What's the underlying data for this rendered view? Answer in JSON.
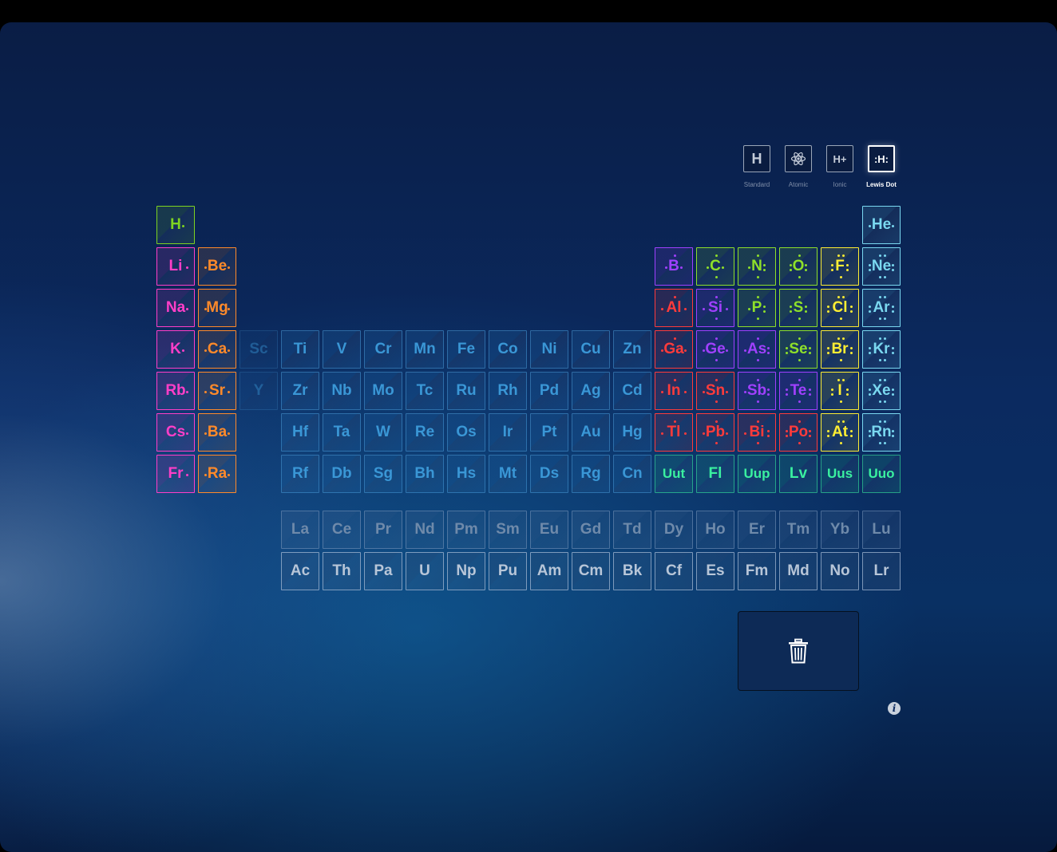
{
  "modes": [
    {
      "id": "standard",
      "icon_text": "H",
      "label": "Standard",
      "selected": false
    },
    {
      "id": "atomic",
      "icon_text": "",
      "icon": "atom-icon",
      "label": "Atomic",
      "selected": false
    },
    {
      "id": "ionic",
      "icon_text": "H+",
      "label": "Ionic",
      "selected": false
    },
    {
      "id": "lewis",
      "icon_text": ":H:",
      "label": "Lewis Dot",
      "selected": true
    }
  ],
  "colors": {
    "alkali": "#ff3ec8",
    "alkaline": "#ff8a2a",
    "hydrogen": "#7ed321",
    "transition": "#2f8fd0",
    "post_transition": "#ff3b3b",
    "metalloid": "#a040ff",
    "nonmetal": "#8ee02a",
    "halogen": "#ffee33",
    "noble": "#7ad8f0",
    "unknown": "#3af0a0",
    "lanthanide": "#6a86a8",
    "actinide": "#b7c4d6"
  },
  "elements": [
    {
      "s": "H",
      "r": 1,
      "c": 1,
      "k": "hydrogen",
      "v": 1
    },
    {
      "s": "He",
      "r": 1,
      "c": 18,
      "k": "noble",
      "v": 2
    },
    {
      "s": "Li",
      "r": 2,
      "c": 1,
      "k": "alkali",
      "v": 1
    },
    {
      "s": "Be",
      "r": 2,
      "c": 2,
      "k": "alkaline",
      "v": 2
    },
    {
      "s": "B",
      "r": 2,
      "c": 13,
      "k": "metalloid",
      "v": 3
    },
    {
      "s": "C",
      "r": 2,
      "c": 14,
      "k": "nonmetal",
      "v": 4
    },
    {
      "s": "N",
      "r": 2,
      "c": 15,
      "k": "nonmetal",
      "v": 5
    },
    {
      "s": "O",
      "r": 2,
      "c": 16,
      "k": "nonmetal",
      "v": 6
    },
    {
      "s": "F",
      "r": 2,
      "c": 17,
      "k": "halogen",
      "v": 7
    },
    {
      "s": "Ne",
      "r": 2,
      "c": 18,
      "k": "noble",
      "v": 8
    },
    {
      "s": "Na",
      "r": 3,
      "c": 1,
      "k": "alkali",
      "v": 1
    },
    {
      "s": "Mg",
      "r": 3,
      "c": 2,
      "k": "alkaline",
      "v": 2
    },
    {
      "s": "Al",
      "r": 3,
      "c": 13,
      "k": "post_transition",
      "v": 3
    },
    {
      "s": "Si",
      "r": 3,
      "c": 14,
      "k": "metalloid",
      "v": 4
    },
    {
      "s": "P",
      "r": 3,
      "c": 15,
      "k": "nonmetal",
      "v": 5
    },
    {
      "s": "S",
      "r": 3,
      "c": 16,
      "k": "nonmetal",
      "v": 6
    },
    {
      "s": "Cl",
      "r": 3,
      "c": 17,
      "k": "halogen",
      "v": 7
    },
    {
      "s": "Ar",
      "r": 3,
      "c": 18,
      "k": "noble",
      "v": 8
    },
    {
      "s": "K",
      "r": 4,
      "c": 1,
      "k": "alkali",
      "v": 1
    },
    {
      "s": "Ca",
      "r": 4,
      "c": 2,
      "k": "alkaline",
      "v": 2
    },
    {
      "s": "Sc",
      "r": 4,
      "c": 3,
      "k": "transition",
      "v": 0
    },
    {
      "s": "Ti",
      "r": 4,
      "c": 4,
      "k": "transition",
      "v": 0
    },
    {
      "s": "V",
      "r": 4,
      "c": 5,
      "k": "transition",
      "v": 0
    },
    {
      "s": "Cr",
      "r": 4,
      "c": 6,
      "k": "transition",
      "v": 0
    },
    {
      "s": "Mn",
      "r": 4,
      "c": 7,
      "k": "transition",
      "v": 0
    },
    {
      "s": "Fe",
      "r": 4,
      "c": 8,
      "k": "transition",
      "v": 0
    },
    {
      "s": "Co",
      "r": 4,
      "c": 9,
      "k": "transition",
      "v": 0
    },
    {
      "s": "Ni",
      "r": 4,
      "c": 10,
      "k": "transition",
      "v": 0
    },
    {
      "s": "Cu",
      "r": 4,
      "c": 11,
      "k": "transition",
      "v": 0
    },
    {
      "s": "Zn",
      "r": 4,
      "c": 12,
      "k": "transition",
      "v": 0
    },
    {
      "s": "Ga",
      "r": 4,
      "c": 13,
      "k": "post_transition",
      "v": 3
    },
    {
      "s": "Ge",
      "r": 4,
      "c": 14,
      "k": "metalloid",
      "v": 4
    },
    {
      "s": "As",
      "r": 4,
      "c": 15,
      "k": "metalloid",
      "v": 5
    },
    {
      "s": "Se",
      "r": 4,
      "c": 16,
      "k": "nonmetal",
      "v": 6
    },
    {
      "s": "Br",
      "r": 4,
      "c": 17,
      "k": "halogen",
      "v": 7
    },
    {
      "s": "Kr",
      "r": 4,
      "c": 18,
      "k": "noble",
      "v": 8
    },
    {
      "s": "Rb",
      "r": 5,
      "c": 1,
      "k": "alkali",
      "v": 1
    },
    {
      "s": "Sr",
      "r": 5,
      "c": 2,
      "k": "alkaline",
      "v": 2
    },
    {
      "s": "Y",
      "r": 5,
      "c": 3,
      "k": "transition",
      "v": 0
    },
    {
      "s": "Zr",
      "r": 5,
      "c": 4,
      "k": "transition",
      "v": 0
    },
    {
      "s": "Nb",
      "r": 5,
      "c": 5,
      "k": "transition",
      "v": 0
    },
    {
      "s": "Mo",
      "r": 5,
      "c": 6,
      "k": "transition",
      "v": 0
    },
    {
      "s": "Tc",
      "r": 5,
      "c": 7,
      "k": "transition",
      "v": 0
    },
    {
      "s": "Ru",
      "r": 5,
      "c": 8,
      "k": "transition",
      "v": 0
    },
    {
      "s": "Rh",
      "r": 5,
      "c": 9,
      "k": "transition",
      "v": 0
    },
    {
      "s": "Pd",
      "r": 5,
      "c": 10,
      "k": "transition",
      "v": 0
    },
    {
      "s": "Ag",
      "r": 5,
      "c": 11,
      "k": "transition",
      "v": 0
    },
    {
      "s": "Cd",
      "r": 5,
      "c": 12,
      "k": "transition",
      "v": 0
    },
    {
      "s": "In",
      "r": 5,
      "c": 13,
      "k": "post_transition",
      "v": 3
    },
    {
      "s": "Sn",
      "r": 5,
      "c": 14,
      "k": "post_transition",
      "v": 4
    },
    {
      "s": "Sb",
      "r": 5,
      "c": 15,
      "k": "metalloid",
      "v": 5
    },
    {
      "s": "Te",
      "r": 5,
      "c": 16,
      "k": "metalloid",
      "v": 6
    },
    {
      "s": "I",
      "r": 5,
      "c": 17,
      "k": "halogen",
      "v": 7
    },
    {
      "s": "Xe",
      "r": 5,
      "c": 18,
      "k": "noble",
      "v": 8
    },
    {
      "s": "Cs",
      "r": 6,
      "c": 1,
      "k": "alkali",
      "v": 1
    },
    {
      "s": "Ba",
      "r": 6,
      "c": 2,
      "k": "alkaline",
      "v": 2
    },
    {
      "s": "Hf",
      "r": 6,
      "c": 4,
      "k": "transition",
      "v": 0
    },
    {
      "s": "Ta",
      "r": 6,
      "c": 5,
      "k": "transition",
      "v": 0
    },
    {
      "s": "W",
      "r": 6,
      "c": 6,
      "k": "transition",
      "v": 0
    },
    {
      "s": "Re",
      "r": 6,
      "c": 7,
      "k": "transition",
      "v": 0
    },
    {
      "s": "Os",
      "r": 6,
      "c": 8,
      "k": "transition",
      "v": 0
    },
    {
      "s": "Ir",
      "r": 6,
      "c": 9,
      "k": "transition",
      "v": 0
    },
    {
      "s": "Pt",
      "r": 6,
      "c": 10,
      "k": "transition",
      "v": 0
    },
    {
      "s": "Au",
      "r": 6,
      "c": 11,
      "k": "transition",
      "v": 0
    },
    {
      "s": "Hg",
      "r": 6,
      "c": 12,
      "k": "transition",
      "v": 0
    },
    {
      "s": "Tl",
      "r": 6,
      "c": 13,
      "k": "post_transition",
      "v": 3
    },
    {
      "s": "Pb",
      "r": 6,
      "c": 14,
      "k": "post_transition",
      "v": 4
    },
    {
      "s": "Bi",
      "r": 6,
      "c": 15,
      "k": "post_transition",
      "v": 5
    },
    {
      "s": "Po",
      "r": 6,
      "c": 16,
      "k": "post_transition",
      "v": 6
    },
    {
      "s": "At",
      "r": 6,
      "c": 17,
      "k": "halogen",
      "v": 7
    },
    {
      "s": "Rn",
      "r": 6,
      "c": 18,
      "k": "noble",
      "v": 8
    },
    {
      "s": "Fr",
      "r": 7,
      "c": 1,
      "k": "alkali",
      "v": 1
    },
    {
      "s": "Ra",
      "r": 7,
      "c": 2,
      "k": "alkaline",
      "v": 2
    },
    {
      "s": "Rf",
      "r": 7,
      "c": 4,
      "k": "transition",
      "v": 0
    },
    {
      "s": "Db",
      "r": 7,
      "c": 5,
      "k": "transition",
      "v": 0
    },
    {
      "s": "Sg",
      "r": 7,
      "c": 6,
      "k": "transition",
      "v": 0
    },
    {
      "s": "Bh",
      "r": 7,
      "c": 7,
      "k": "transition",
      "v": 0
    },
    {
      "s": "Hs",
      "r": 7,
      "c": 8,
      "k": "transition",
      "v": 0
    },
    {
      "s": "Mt",
      "r": 7,
      "c": 9,
      "k": "transition",
      "v": 0
    },
    {
      "s": "Ds",
      "r": 7,
      "c": 10,
      "k": "transition",
      "v": 0
    },
    {
      "s": "Rg",
      "r": 7,
      "c": 11,
      "k": "transition",
      "v": 0
    },
    {
      "s": "Cn",
      "r": 7,
      "c": 12,
      "k": "transition",
      "v": 0
    },
    {
      "s": "Uut",
      "r": 7,
      "c": 13,
      "k": "unknown",
      "v": 0
    },
    {
      "s": "Fl",
      "r": 7,
      "c": 14,
      "k": "unknown",
      "v": 0
    },
    {
      "s": "Uup",
      "r": 7,
      "c": 15,
      "k": "unknown",
      "v": 0
    },
    {
      "s": "Lv",
      "r": 7,
      "c": 16,
      "k": "unknown",
      "v": 0
    },
    {
      "s": "Uus",
      "r": 7,
      "c": 17,
      "k": "unknown",
      "v": 0
    },
    {
      "s": "Uuo",
      "r": 7,
      "c": 18,
      "k": "unknown",
      "v": 0
    },
    {
      "s": "La",
      "r": 8,
      "c": 4,
      "k": "lanthanide",
      "v": 0
    },
    {
      "s": "Ce",
      "r": 8,
      "c": 5,
      "k": "lanthanide",
      "v": 0
    },
    {
      "s": "Pr",
      "r": 8,
      "c": 6,
      "k": "lanthanide",
      "v": 0
    },
    {
      "s": "Nd",
      "r": 8,
      "c": 7,
      "k": "lanthanide",
      "v": 0
    },
    {
      "s": "Pm",
      "r": 8,
      "c": 8,
      "k": "lanthanide",
      "v": 0
    },
    {
      "s": "Sm",
      "r": 8,
      "c": 9,
      "k": "lanthanide",
      "v": 0
    },
    {
      "s": "Eu",
      "r": 8,
      "c": 10,
      "k": "lanthanide",
      "v": 0
    },
    {
      "s": "Gd",
      "r": 8,
      "c": 11,
      "k": "lanthanide",
      "v": 0
    },
    {
      "s": "Td",
      "r": 8,
      "c": 12,
      "k": "lanthanide",
      "v": 0
    },
    {
      "s": "Dy",
      "r": 8,
      "c": 13,
      "k": "lanthanide",
      "v": 0
    },
    {
      "s": "Ho",
      "r": 8,
      "c": 14,
      "k": "lanthanide",
      "v": 0
    },
    {
      "s": "Er",
      "r": 8,
      "c": 15,
      "k": "lanthanide",
      "v": 0
    },
    {
      "s": "Tm",
      "r": 8,
      "c": 16,
      "k": "lanthanide",
      "v": 0
    },
    {
      "s": "Yb",
      "r": 8,
      "c": 17,
      "k": "lanthanide",
      "v": 0
    },
    {
      "s": "Lu",
      "r": 8,
      "c": 18,
      "k": "lanthanide",
      "v": 0
    },
    {
      "s": "Ac",
      "r": 9,
      "c": 4,
      "k": "actinide",
      "v": 0
    },
    {
      "s": "Th",
      "r": 9,
      "c": 5,
      "k": "actinide",
      "v": 0
    },
    {
      "s": "Pa",
      "r": 9,
      "c": 6,
      "k": "actinide",
      "v": 0
    },
    {
      "s": "U",
      "r": 9,
      "c": 7,
      "k": "actinide",
      "v": 0
    },
    {
      "s": "Np",
      "r": 9,
      "c": 8,
      "k": "actinide",
      "v": 0
    },
    {
      "s": "Pu",
      "r": 9,
      "c": 9,
      "k": "actinide",
      "v": 0
    },
    {
      "s": "Am",
      "r": 9,
      "c": 10,
      "k": "actinide",
      "v": 0
    },
    {
      "s": "Cm",
      "r": 9,
      "c": 11,
      "k": "actinide",
      "v": 0
    },
    {
      "s": "Bk",
      "r": 9,
      "c": 12,
      "k": "actinide",
      "v": 0
    },
    {
      "s": "Cf",
      "r": 9,
      "c": 13,
      "k": "actinide",
      "v": 0
    },
    {
      "s": "Es",
      "r": 9,
      "c": 14,
      "k": "actinide",
      "v": 0
    },
    {
      "s": "Fm",
      "r": 9,
      "c": 15,
      "k": "actinide",
      "v": 0
    },
    {
      "s": "Md",
      "r": 9,
      "c": 16,
      "k": "actinide",
      "v": 0
    },
    {
      "s": "No",
      "r": 9,
      "c": 17,
      "k": "actinide",
      "v": 0
    },
    {
      "s": "Lr",
      "r": 9,
      "c": 18,
      "k": "actinide",
      "v": 0
    }
  ],
  "trash": {
    "icon": "trash-icon"
  },
  "info": {
    "icon": "info-icon",
    "glyph": "i"
  }
}
